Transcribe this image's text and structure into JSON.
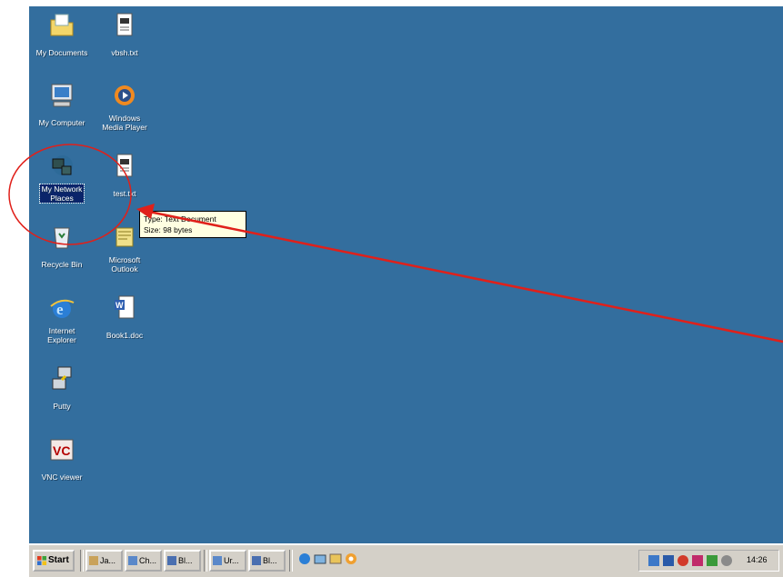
{
  "desktop": {
    "icons": [
      {
        "label": "My Documents",
        "icon": "folder-icon"
      },
      {
        "label": "vbsh.txt",
        "icon": "text-file-icon"
      },
      {
        "label": "My Computer",
        "icon": "computer-icon"
      },
      {
        "label": "Windows\nMedia Player",
        "icon": "media-player-icon"
      },
      {
        "label": "My Network\nPlaces",
        "icon": "network-icon"
      },
      {
        "label": "test.txt",
        "icon": "text-file-icon"
      },
      {
        "label": "Recycle Bin",
        "icon": "recycle-bin-icon"
      },
      {
        "label": "Microsoft\nOutlook",
        "icon": "outlook-icon"
      },
      {
        "label": "Internet\nExplorer",
        "icon": "ie-icon"
      },
      {
        "label": "Book1.doc",
        "icon": "word-doc-icon"
      },
      {
        "label": "Putty",
        "icon": "putty-icon"
      },
      {
        "label": "VNC viewer",
        "icon": "vnc-icon"
      }
    ],
    "selected": "My Network Places",
    "background_color": "#336e9e"
  },
  "tooltip": {
    "line1": "Type: Text Document",
    "line2": "Size: 98 bytes"
  },
  "taskbar": {
    "start_label": "Start",
    "tasks": [
      "Ja...",
      "Ch...",
      "Bl...",
      "Ur...",
      "Bl..."
    ],
    "clock": "14:26"
  },
  "annotation": {
    "circle_color": "#e0201a",
    "arrow_color": "#e0201a"
  }
}
